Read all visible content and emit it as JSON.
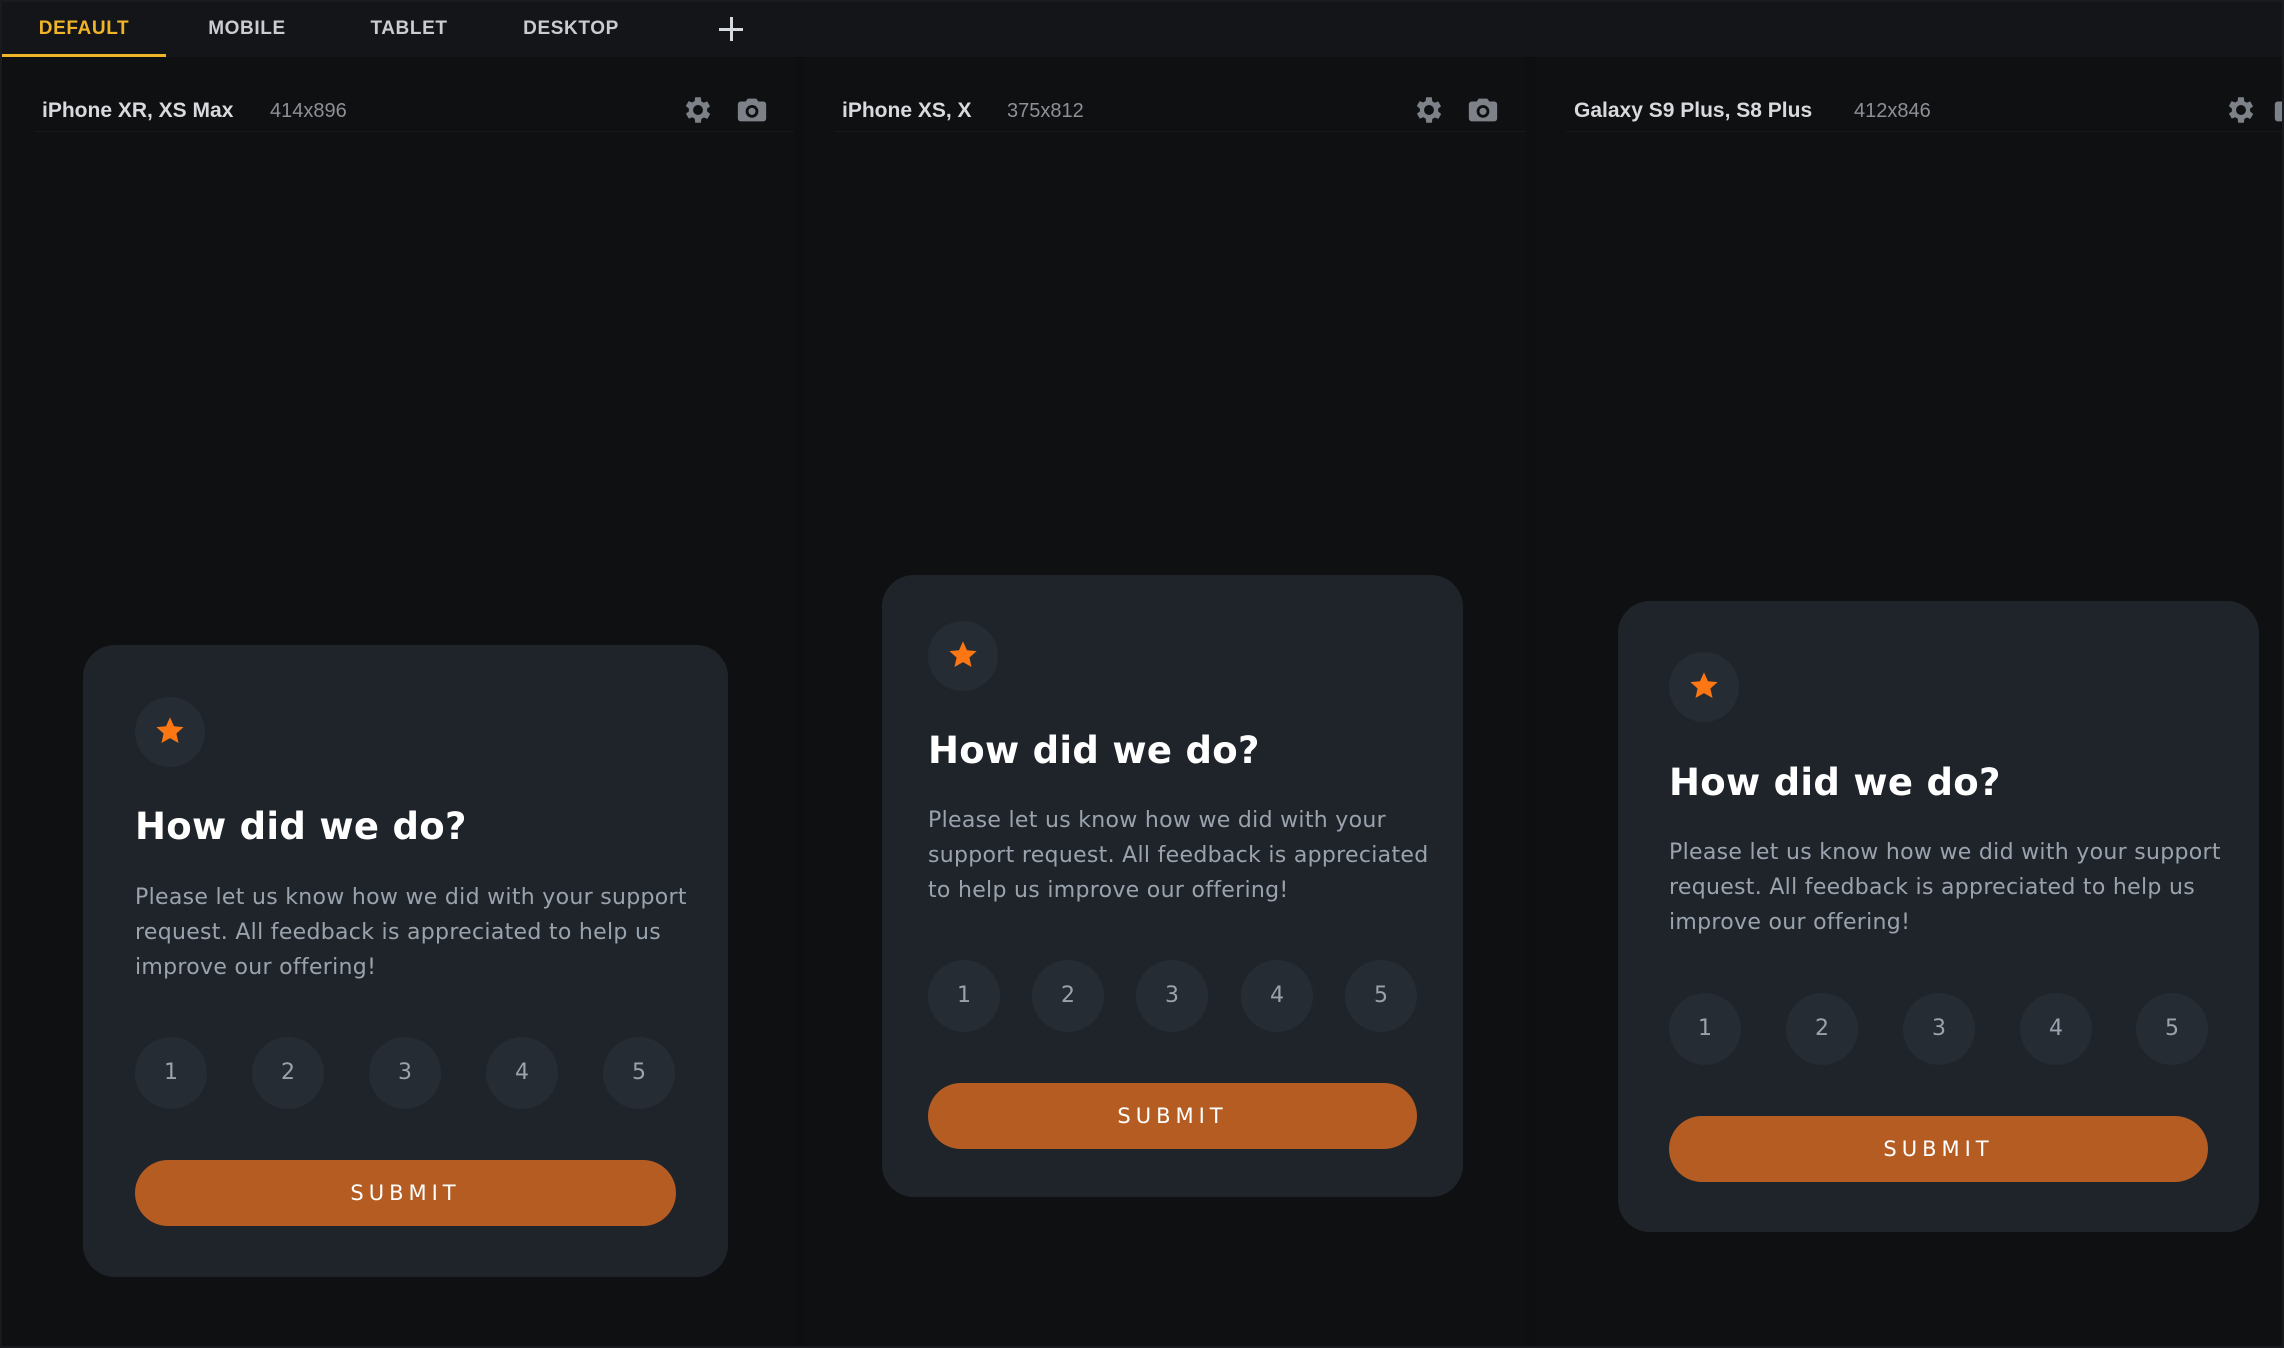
{
  "tabs": [
    {
      "label": "DEFAULT",
      "active": true
    },
    {
      "label": "MOBILE",
      "active": false
    },
    {
      "label": "TABLET",
      "active": false
    },
    {
      "label": "DESKTOP",
      "active": false
    }
  ],
  "add_tab_icon": "plus-icon",
  "colors": {
    "accent": "#f0b429",
    "card_bg": "#1f242b",
    "star": "#fc7614",
    "submit": "#b55c23"
  },
  "devices": [
    {
      "name": "iPhone XR, XS Max",
      "size": "414x896",
      "settings_icon": "gear-icon",
      "screenshot_icon": "camera-icon"
    },
    {
      "name": "iPhone XS, X",
      "size": "375x812",
      "settings_icon": "gear-icon",
      "screenshot_icon": "camera-icon"
    },
    {
      "name": "Galaxy S9 Plus, S8 Plus",
      "size": "412x846",
      "settings_icon": "gear-icon",
      "screenshot_icon": "camera-icon"
    }
  ],
  "card": {
    "icon": "star-icon",
    "title": "How did we do?",
    "text_lines": [
      [
        "Please let us know how we did with your support",
        "request. All feedback is appreciated to help us",
        "improve our offering!"
      ],
      [
        "Please let us know how we did with your",
        "support request. All feedback is appreciated",
        "to help us improve our offering!"
      ],
      [
        "Please let us know how we did with your support",
        "request. All feedback is appreciated to help us",
        "improve our offering!"
      ]
    ],
    "ratings": [
      "1",
      "2",
      "3",
      "4",
      "5"
    ],
    "submit": "SUBMIT"
  }
}
